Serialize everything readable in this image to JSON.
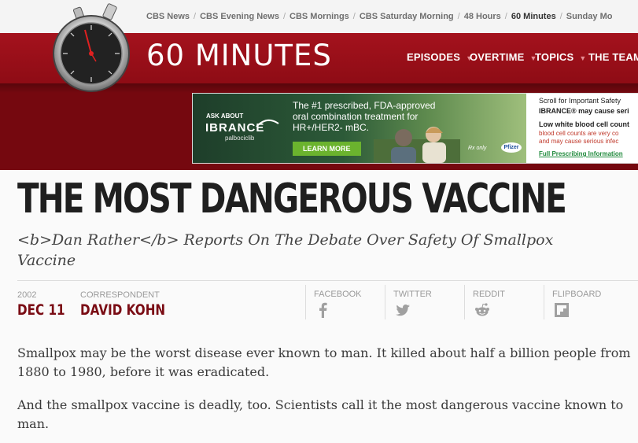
{
  "network_links": [
    "CBS News",
    "CBS Evening News",
    "CBS Mornings",
    "CBS Saturday Morning",
    "48 Hours",
    "60 Minutes",
    "Sunday Mo"
  ],
  "active_link": "60 Minutes",
  "brand": {
    "logo_text": "60 MINUTES"
  },
  "nav": [
    "EPISODES",
    "OVERTIME",
    "TOPICS",
    "THE TEAM"
  ],
  "colors": {
    "header_red": "#a4121d",
    "banner_red": "#75080f",
    "accent": "#7a0c14",
    "cta_green": "#6bb32e"
  },
  "ad": {
    "ask_about": "ASK ABOUT",
    "brand": "IBRANCE",
    "generic": "palbociclib",
    "headline_1": "The #1 prescribed, FDA-approved",
    "headline_2": "oral combination treatment for",
    "headline_3": "HR+/HER2- mBC.",
    "cta": "LEARN MORE",
    "rx": "Rx only",
    "pfizer": "Pfizer",
    "side_1": "Scroll for Important Safety",
    "side_2": "IBRANCE® may cause seri",
    "side_3": "Low white blood cell count",
    "side_4": "blood cell counts are very co",
    "side_5": "and may cause serious infec",
    "side_6": "Full Prescribing Information"
  },
  "article": {
    "headline": "THE MOST DANGEROUS VACCINE",
    "dek": "<b>Dan Rather</b> Reports On The Debate Over Safety Of Smallpox Vaccine",
    "year": "2002",
    "date": "DEC 11",
    "correspondent_label": "CORRESPONDENT",
    "correspondent": "DAVID KOHN",
    "share": [
      "FACEBOOK",
      "TWITTER",
      "REDDIT",
      "FLIPBOARD"
    ],
    "paragraphs": [
      "Smallpox may be the worst disease ever known to man. It killed about half a billion people from 1880 to 1980, before it was eradicated.",
      "And the smallpox vaccine is deadly, too. Scientists call it the most dangerous vaccine known to man."
    ]
  }
}
